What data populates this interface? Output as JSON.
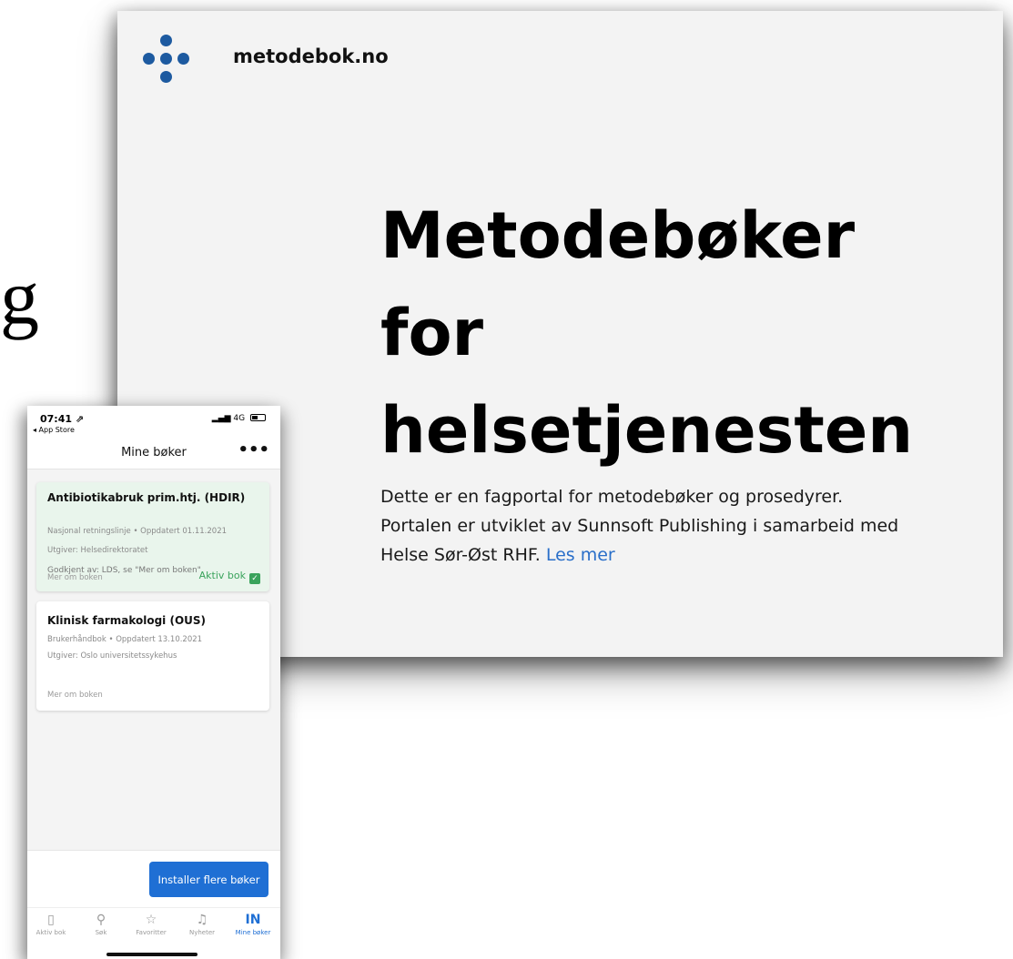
{
  "slide_fragment": "g",
  "website": {
    "site_name": "metodebok.no",
    "hero_title_lines": [
      "Metodebøker",
      "for",
      "helsetjenesten"
    ],
    "description_lines": [
      "Dette er en fagportal for metodebøker og prosedyrer.",
      "Portalen er utviklet av Sunnsoft Publishing i samarbeid med",
      "Helse Sør-Øst RHF."
    ],
    "read_more_link": "Les mer",
    "brand_color": "#1d5aa0"
  },
  "phone": {
    "status": {
      "time": "07:41 ⇗",
      "back_label": "◂ App Store",
      "signal": "4G"
    },
    "nav": {
      "title": "Mine bøker",
      "more": "•••"
    },
    "books": [
      {
        "title": "Antibiotikabruk prim.htj. (HDIR)",
        "meta": "Nasjonal retningslinje • Oppdatert 01.11.2021",
        "publisher": "Utgiver: Helsedirektoratet",
        "approved": "Godkjent av: LDS, se \"Mer om boken\"",
        "link": "Mer om boken",
        "badge": "Aktiv bok",
        "active": true
      },
      {
        "title": "Klinisk farmakologi (OUS)",
        "meta": "Brukerhåndbok • Oppdatert 13.10.2021",
        "publisher": "Utgiver: Oslo universitetssykehus",
        "link": "Mer om boken",
        "active": false
      }
    ],
    "install_button": "Installer flere bøker",
    "tabs": [
      {
        "icon": "book-icon",
        "glyph": "▯",
        "label": "Aktiv bok",
        "selected": false
      },
      {
        "icon": "search-icon",
        "glyph": "⚲",
        "label": "Søk",
        "selected": false
      },
      {
        "icon": "star-icon",
        "glyph": "☆",
        "label": "Favoritter",
        "selected": false
      },
      {
        "icon": "bell-icon",
        "glyph": "♫",
        "label": "Nyheter",
        "selected": false
      },
      {
        "icon": "library-icon",
        "glyph": "IN",
        "label": "Mine bøker",
        "selected": true
      }
    ],
    "accent_color": "#1f6fd4",
    "active_color": "#3aa35c"
  }
}
